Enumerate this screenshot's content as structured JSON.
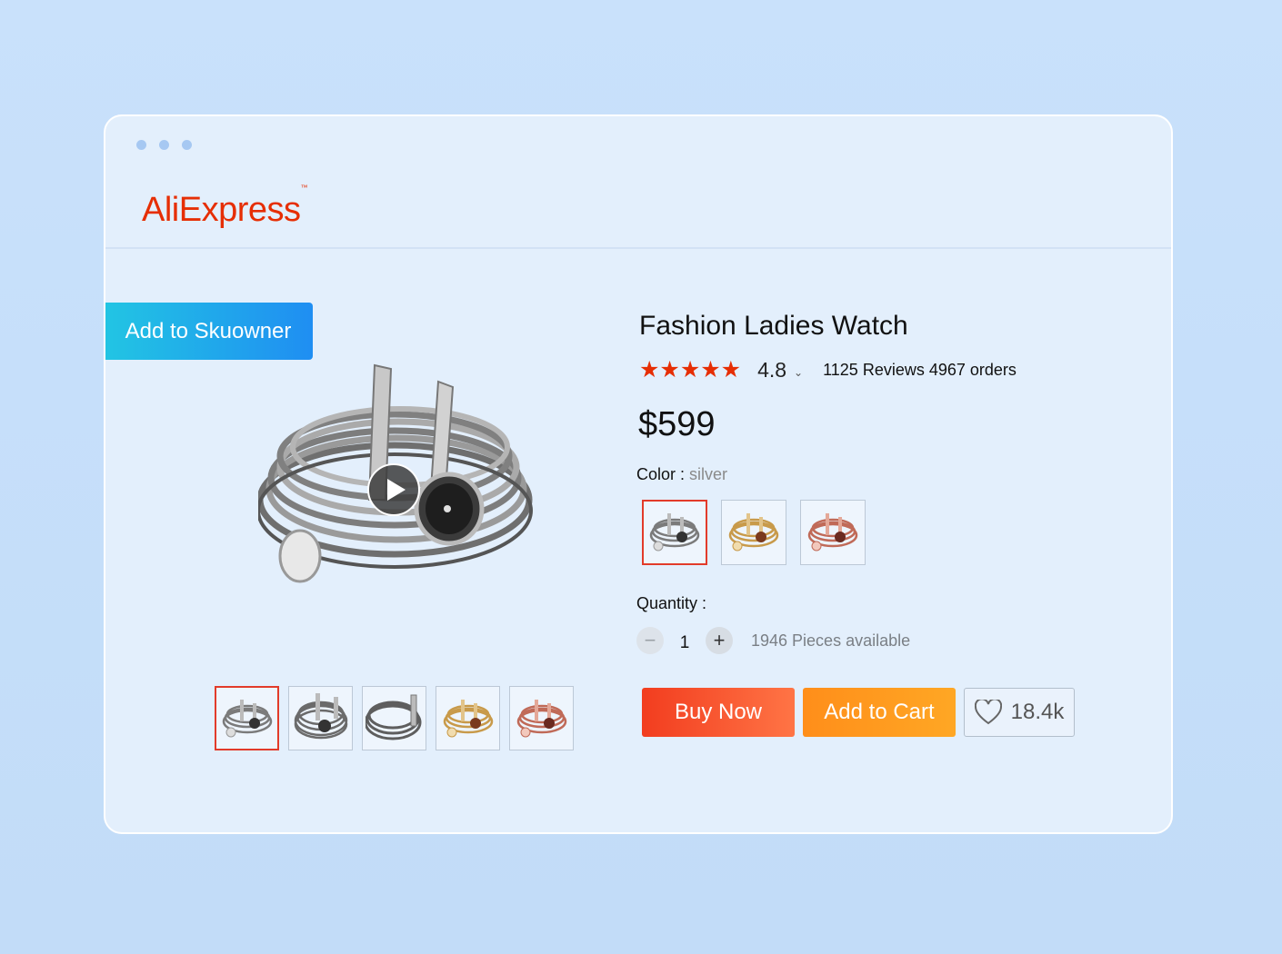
{
  "window": {
    "dots": 3
  },
  "brand": {
    "name": "AliExpress",
    "trademark": "™",
    "color": "#e62e04"
  },
  "sku_button": {
    "label": "Add to Skuowner"
  },
  "product": {
    "title": "Fashion Ladies Watch",
    "stars": "★★★★★",
    "rating": "4.8",
    "rating_dropdown": "⌄",
    "reviews_orders": "1125 Reviews 4967 orders",
    "price": "$599",
    "color_label": "Color : ",
    "color_value": "silver",
    "swatches": [
      "silver",
      "gold",
      "rose-gold"
    ],
    "selected_swatch": "silver",
    "quantity_label": "Quantity :",
    "quantity_value": "1",
    "minus_symbol": "−",
    "plus_symbol": "+",
    "availability": "1946 Pieces available"
  },
  "gallery": {
    "thumbnails": [
      "silver",
      "silver",
      "silver",
      "gold",
      "rose-gold"
    ],
    "selected_index": 0
  },
  "actions": {
    "buy_now": "Buy Now",
    "add_to_cart": "Add to Cart",
    "wishlist_count": "18.4k"
  },
  "colors": {
    "accent_red": "#e62e04",
    "buy_gradient": [
      "#f23d1f",
      "#ff7445"
    ],
    "cart_gradient": [
      "#ff8e1a",
      "#ffa724"
    ],
    "sku_gradient": [
      "#22c5e3",
      "#1f8ef2"
    ]
  }
}
